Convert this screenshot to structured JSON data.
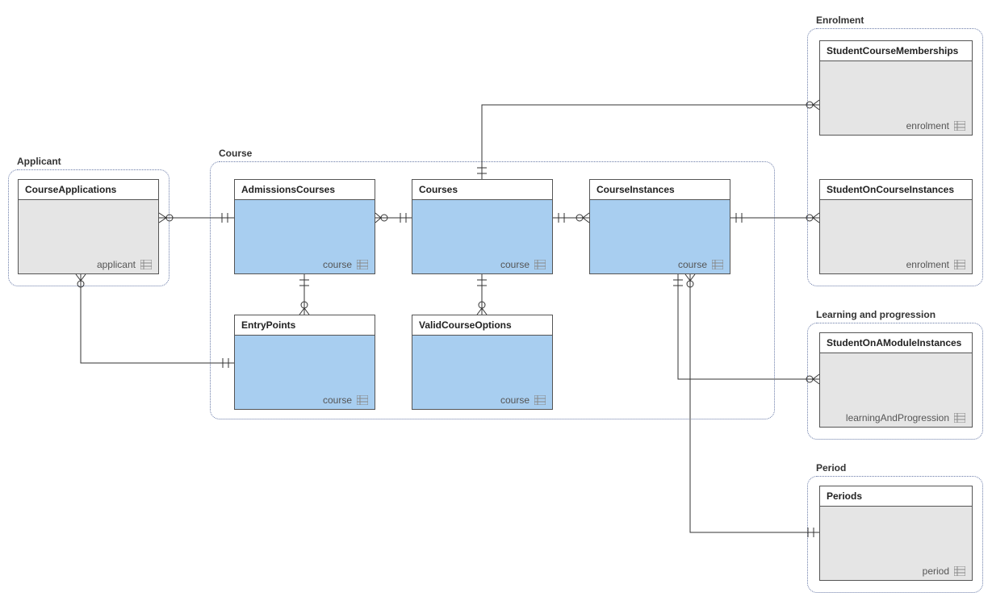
{
  "containers": {
    "applicant": {
      "label": "Applicant"
    },
    "course": {
      "label": "Course"
    },
    "enrolment": {
      "label": "Enrolment"
    },
    "learning": {
      "label": "Learning and progression"
    },
    "period": {
      "label": "Period"
    }
  },
  "entities": {
    "courseApplications": {
      "title": "CourseApplications",
      "schema": "applicant"
    },
    "admissionsCourses": {
      "title": "AdmissionsCourses",
      "schema": "course"
    },
    "courses": {
      "title": "Courses",
      "schema": "course"
    },
    "courseInstances": {
      "title": "CourseInstances",
      "schema": "course"
    },
    "entryPoints": {
      "title": "EntryPoints",
      "schema": "course"
    },
    "validCourseOptions": {
      "title": "ValidCourseOptions",
      "schema": "course"
    },
    "studentCourseMemberships": {
      "title": "StudentCourseMemberships",
      "schema": "enrolment"
    },
    "studentOnCourseInstances": {
      "title": "StudentOnCourseInstances",
      "schema": "enrolment"
    },
    "studentOnAModuleInstances": {
      "title": "StudentOnAModuleInstances",
      "schema": "learningAndProgression"
    },
    "periods": {
      "title": "Periods",
      "schema": "period"
    }
  }
}
